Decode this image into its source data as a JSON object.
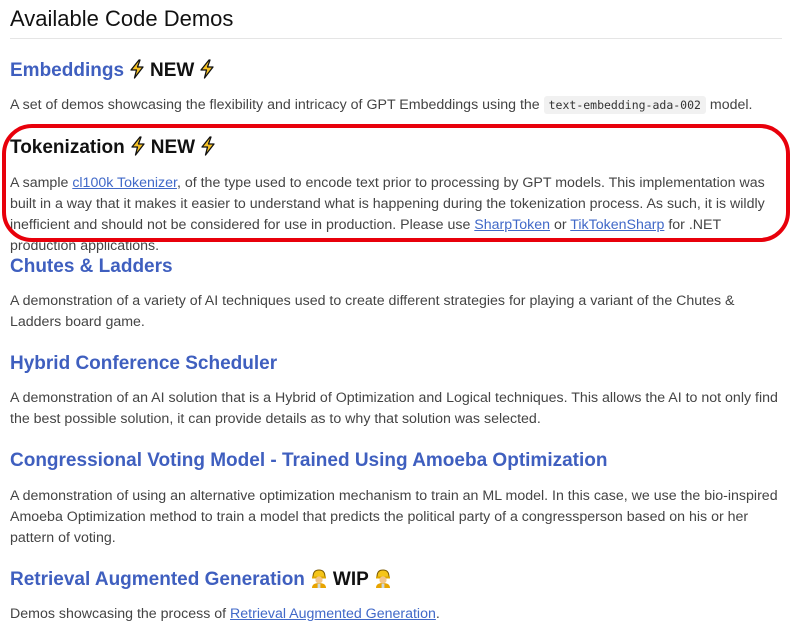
{
  "page": {
    "title": "Available Code Demos"
  },
  "demos": [
    {
      "title": "Embeddings",
      "badge": "NEW",
      "badge_icon": "lightning-bolt-icon",
      "desc_before_code": "A set of demos showcasing the flexibility and intricacy of GPT Embeddings using the ",
      "code": "text-embedding-ada-002",
      "desc_after_code": " model."
    },
    {
      "title": "Tokenization",
      "badge": "NEW",
      "badge_icon": "lightning-bolt-icon",
      "desc_part1": "A sample ",
      "link1": "cl100k Tokenizer",
      "desc_part2": ", of the type used to encode text prior to processing by GPT models. This implementation was built in a way that it makes it easier to understand what is happening during the tokenization process. As such, it is wildly inefficient and should not be considered for use in production. Please use ",
      "link2": "SharpToken",
      "desc_part3": " or ",
      "link3": "TikTokenSharp",
      "desc_part4": " for .NET production applications."
    },
    {
      "title": "Chutes & Ladders",
      "desc": "A demonstration of a variety of AI techniques used to create different strategies for playing a variant of the Chutes & Ladders board game."
    },
    {
      "title": "Hybrid Conference Scheduler",
      "desc": "A demonstration of an AI solution that is a Hybrid of Optimization and Logical techniques. This allows the AI to not only find the best possible solution, it can provide details as to why that solution was selected."
    },
    {
      "title": "Congressional Voting Model - Trained Using Amoeba Optimization",
      "desc": "A demonstration of using an alternative optimization mechanism to train an ML model. In this case, we use the bio-inspired Amoeba Optimization method to train a model that predicts the political party of a congressperson based on his or her pattern of voting."
    },
    {
      "title": "Retrieval Augmented Generation",
      "badge": "WIP",
      "badge_icon": "construction-worker-icon",
      "desc_before_link": "Demos showcasing the process of ",
      "link": "Retrieval Augmented Generation",
      "desc_after_link": "."
    }
  ],
  "colors": {
    "link": "#3f5fbf",
    "highlight": "#e8000b"
  }
}
